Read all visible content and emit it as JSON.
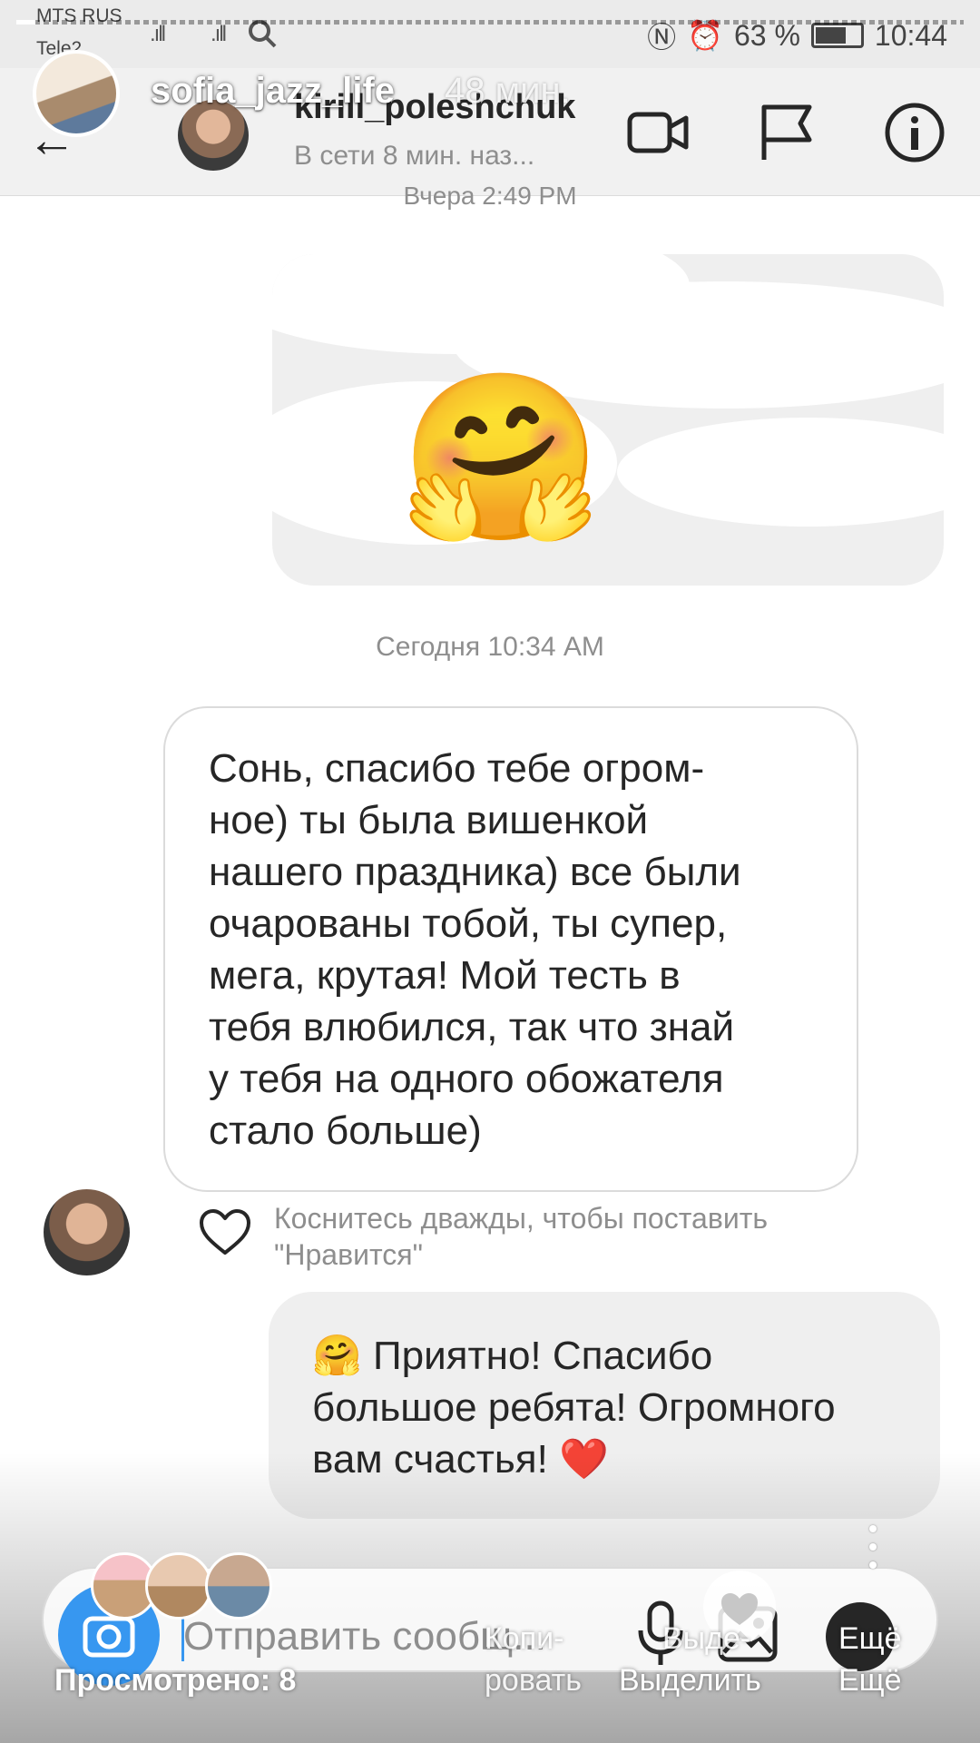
{
  "status_bar": {
    "carrier1": "MTS RUS",
    "carrier2": "Tele2",
    "battery_text": "63 %",
    "battery_level": 0.63,
    "time": "10:44"
  },
  "story_overlay": {
    "username": "sofia_jazz_life",
    "time_ago": "48 мин.",
    "progress": 0.02,
    "viewed_label": "Просмотрено: 8",
    "actions": {
      "copy_label_line1": "Копи-",
      "copy_label_line2": "ровать",
      "select_label_top": "Выде-",
      "select_label": "Выделить",
      "more_label_top": "Ещё",
      "more_label": "Ещё"
    }
  },
  "dm_header": {
    "username": "kirill_poleshchuk",
    "status": "В сети 8 мин. наз...",
    "icons": [
      "back-arrow-icon",
      "video-call-icon",
      "flag-icon",
      "info-icon"
    ]
  },
  "chat": {
    "yesterday_timestamp": "Вчера 2:49 PM",
    "today_timestamp": "Сегодня 10:34 AM",
    "big_emoji": "🤗",
    "incoming_lines": [
      "Сонь, спасибо тебе огром-",
      "ное) ты была вишенкой",
      "нашего праздника) все были",
      "очарованы тобой, ты супер,",
      "мега, крутая! Мой тесть в",
      "тебя влюбился, так что знай",
      "у тебя на одного обожателя",
      "стало больше)"
    ],
    "like_hint_line1": "Коснитесь дважды, чтобы поставить",
    "like_hint_line2": "\"Нравится\"",
    "outgoing_lines": [
      "🤗 Приятно! Спасибо",
      "большое ребята! Огромного",
      "вам счастья! ❤️"
    ]
  },
  "composer": {
    "placeholder": "Отправить сообщ..."
  },
  "colors": {
    "accent": "#3797f0",
    "bubble_gray": "#efefef",
    "secondary_text": "#8e8e8e"
  }
}
